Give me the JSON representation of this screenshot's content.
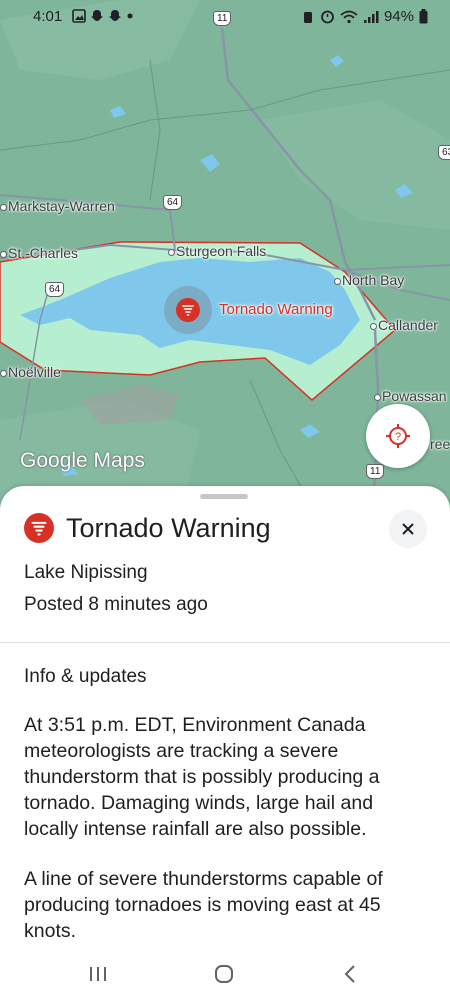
{
  "status_bar": {
    "time": "4:01",
    "battery": "94%"
  },
  "map": {
    "places": {
      "markstay_warren": "Markstay-Warren",
      "st_charles": "St.-Charles",
      "sturgeon_falls": "Sturgeon Falls",
      "north_bay": "North Bay",
      "callander": "Callander",
      "noelville": "Noëlville",
      "powassan": "Powassan",
      "trout_creek": "ree"
    },
    "route_shields": {
      "hwy11_top": "11",
      "hwy63": "63",
      "hwy64_north": "64",
      "hwy64_west": "64",
      "hwy11_bottom": "11"
    },
    "warning_label": "Tornado Warning",
    "logo_text": "Google Maps"
  },
  "sheet": {
    "title": "Tornado Warning",
    "location": "Lake Nipissing",
    "posted": "Posted 8 minutes ago",
    "info_heading": "Info & updates",
    "paragraph_1": "At 3:51 p.m. EDT, Environment Canada meteorologists are tracking a severe thunderstorm that is possibly producing a tornado. Damaging winds, large hail and locally intense rainfall are also possible.",
    "paragraph_2": "A line of severe thunderstorms capable of producing tornadoes is moving east at 45 knots."
  },
  "colors": {
    "alert_red": "#d93025",
    "map_green": "#7fb59b",
    "lake_blue": "#7fc8ec"
  },
  "icons": {
    "warning": "tornado-icon",
    "close": "close-icon",
    "location": "my-location-icon",
    "nav_recents": "recents-icon",
    "nav_home": "home-icon",
    "nav_back": "back-icon"
  }
}
